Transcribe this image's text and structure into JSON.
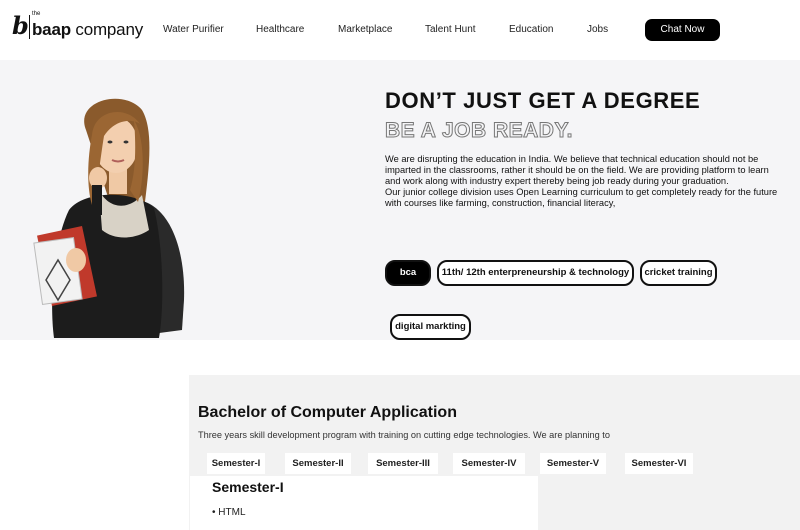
{
  "header": {
    "logo_the": "the",
    "logo_b": "b",
    "logo_baap": "baap",
    "logo_company": " company",
    "nav": [
      "Water Purifier",
      "Healthcare",
      "Marketplace",
      "Talent Hunt",
      "Education",
      "Jobs"
    ],
    "chat_label": "Chat Now"
  },
  "hero": {
    "title": "DON’T JUST GET A DEGREE",
    "subtitle": "BE A JOB READY.",
    "paragraph": "We are disrupting the education in India. We believe that technical education should not be\nimparted in the classrooms, rather it should be on the field. We are providing platform to learn\nand work along with industry expert thereby being job ready during your graduation.\nOur junior college division uses Open Learning curriculum to get completely ready for the future\nwith courses like farming, construction, financial literacy,",
    "chips": [
      "bca",
      "11th/ 12th enterpreneurship & technology",
      "cricket training",
      "digital markting"
    ],
    "active_chip": "bca"
  },
  "course": {
    "title": "Bachelor of Computer Application",
    "description": "Three years skill development program with training on cutting edge technologies. We are planning to",
    "semesters": [
      "Semester-I",
      "Semester-II",
      "Semester-III",
      "Semester-IV",
      "Semester-V",
      "Semester-VI"
    ],
    "panel_title": "Semester-I",
    "panel_items": [
      "HTML"
    ]
  },
  "colors": {
    "hero_bg": "#f5f5f7",
    "course_bg": "#f2f2f2",
    "accent": "#000000"
  }
}
